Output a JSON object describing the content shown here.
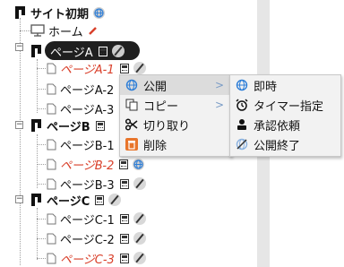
{
  "tree": {
    "root": {
      "label": "サイト初期"
    },
    "home": {
      "label": "ホーム"
    },
    "pageA": {
      "label": "ページA"
    },
    "pageA1": {
      "label": "ページA-1"
    },
    "pageA2": {
      "label": "ページA-2"
    },
    "pageA3": {
      "label": "ページA-3"
    },
    "pageB": {
      "label": "ページB"
    },
    "pageB1": {
      "label": "ページB-1"
    },
    "pageB2": {
      "label": "ページB-2"
    },
    "pageB3": {
      "label": "ページB-3"
    },
    "pageC": {
      "label": "ページC"
    },
    "pageC1": {
      "label": "ページC-1"
    },
    "pageC2": {
      "label": "ページC-2"
    },
    "pageC3": {
      "label": "ページC-3"
    }
  },
  "context_menu": {
    "publish": "公開",
    "copy": "コピー",
    "cut": "切り取り",
    "delete": "削除"
  },
  "submenu": {
    "immediate": "即時",
    "timer": "タイマー指定",
    "approval": "承認依頼",
    "end_publish": "公開終了"
  },
  "colors": {
    "unpublished_text": "#d9402b",
    "selected_bg": "#1f1f1f",
    "menu_bg": "#f2f2f2",
    "globe": "#2f7fd8"
  }
}
